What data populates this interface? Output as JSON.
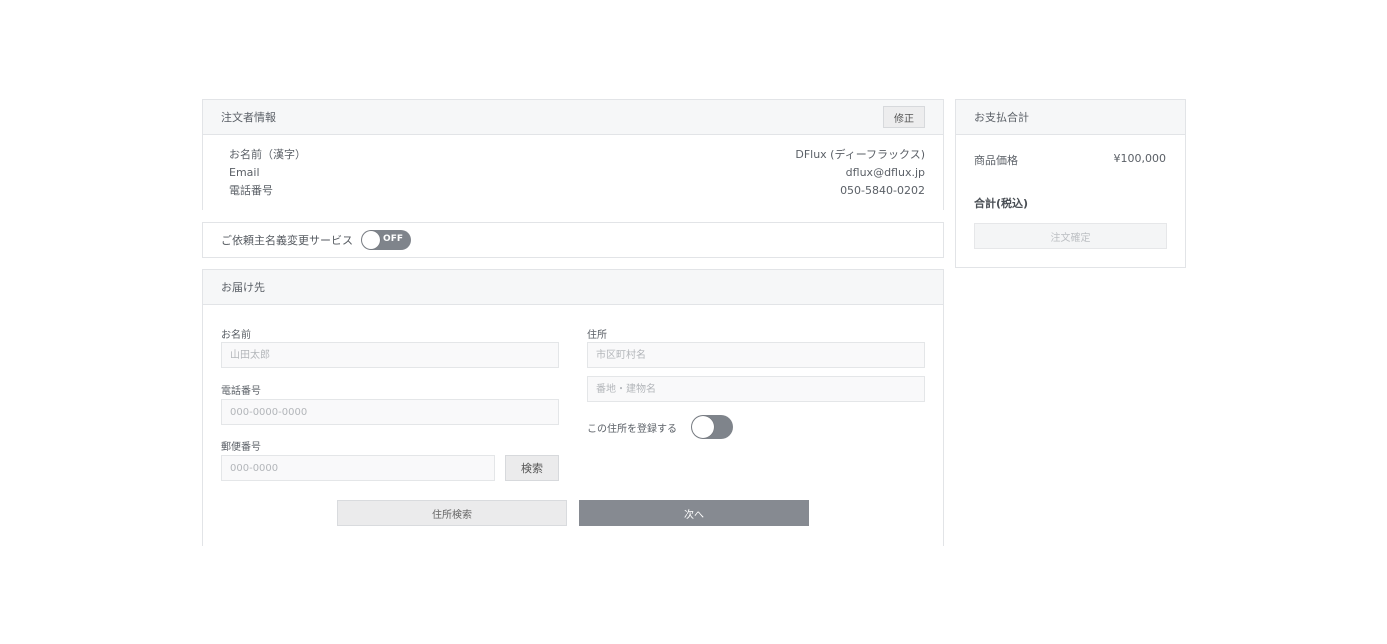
{
  "orderer": {
    "title": "注文者情報",
    "edit_label": "修正",
    "rows": [
      {
        "label": "お名前（漢字）",
        "value": "DFlux (ディーフラックス)"
      },
      {
        "label": "Email",
        "value": "dflux@dflux.jp"
      },
      {
        "label": "電話番号",
        "value": "050-5840-0202"
      }
    ]
  },
  "service": {
    "label": "ご依頼主名義変更サービス",
    "toggle_state": "OFF"
  },
  "delivery": {
    "title": "お届け先",
    "name_label": "お名前",
    "name_placeholder": "山田太郎",
    "phone_label": "電話番号",
    "phone_placeholder": "000-0000-0000",
    "zip_label": "郵便番号",
    "zip_placeholder": "000-0000",
    "zip_search_label": "検索",
    "address_label": "住所",
    "city_placeholder": "市区町村名",
    "street_placeholder": "番地・建物名",
    "register_label": "この住所を登録する",
    "address_search_button": "住所検索",
    "next_button": "次へ"
  },
  "summary": {
    "title": "お支払合計",
    "product_label": "商品価格",
    "product_price": "¥100,000",
    "total_label": "合計(税込)",
    "confirm_label": "注文確定"
  },
  "colors": {
    "accent": "#868a91",
    "border": "#e2e4e7",
    "header_bg": "#f6f7f8"
  }
}
